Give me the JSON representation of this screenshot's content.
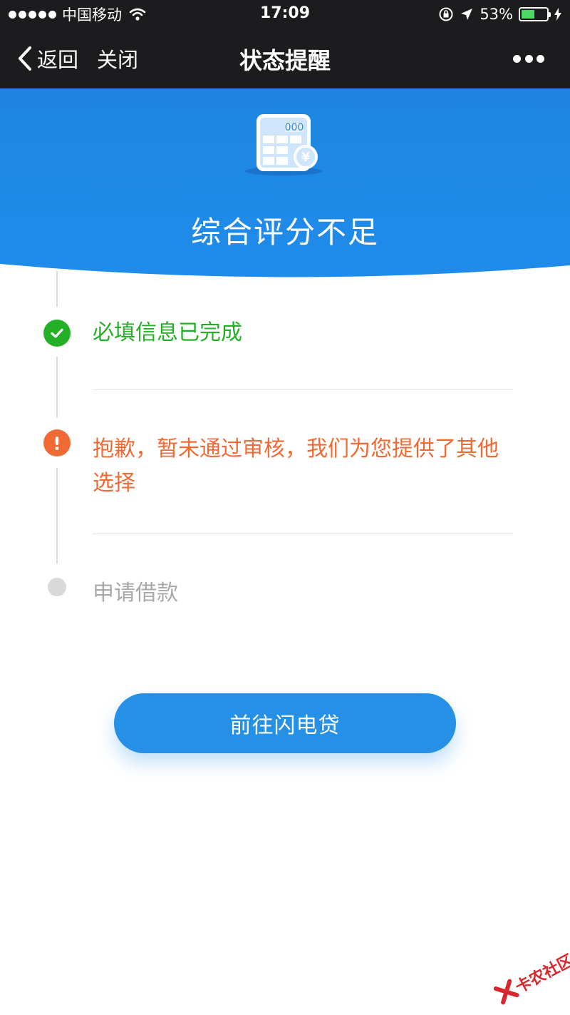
{
  "status_bar": {
    "carrier": "中国移动",
    "time": "17:09",
    "battery": "53%",
    "battery_level": 0.53
  },
  "nav": {
    "back_label": "返回",
    "close_label": "关闭",
    "title": "状态提醒"
  },
  "hero": {
    "icon": "calculator-yen-icon",
    "icon_digits": "000",
    "icon_currency": "¥",
    "title": "综合评分不足",
    "color": "#1e86e0"
  },
  "steps": [
    {
      "state": "done",
      "icon": "check-circle-icon",
      "text": "必填信息已完成",
      "color": "#23b026"
    },
    {
      "state": "error",
      "icon": "exclamation-circle-icon",
      "text": "抱歉，暂未通过审核，我们为您提供了其他选择",
      "color": "#f06a34"
    },
    {
      "state": "pending",
      "icon": "dot-icon",
      "text": "申请借款",
      "color": "#a9a9a9"
    }
  ],
  "action_button": {
    "label": "前往闪电贷",
    "color": "#2590e6"
  },
  "watermark": {
    "text": "卡农社区"
  }
}
